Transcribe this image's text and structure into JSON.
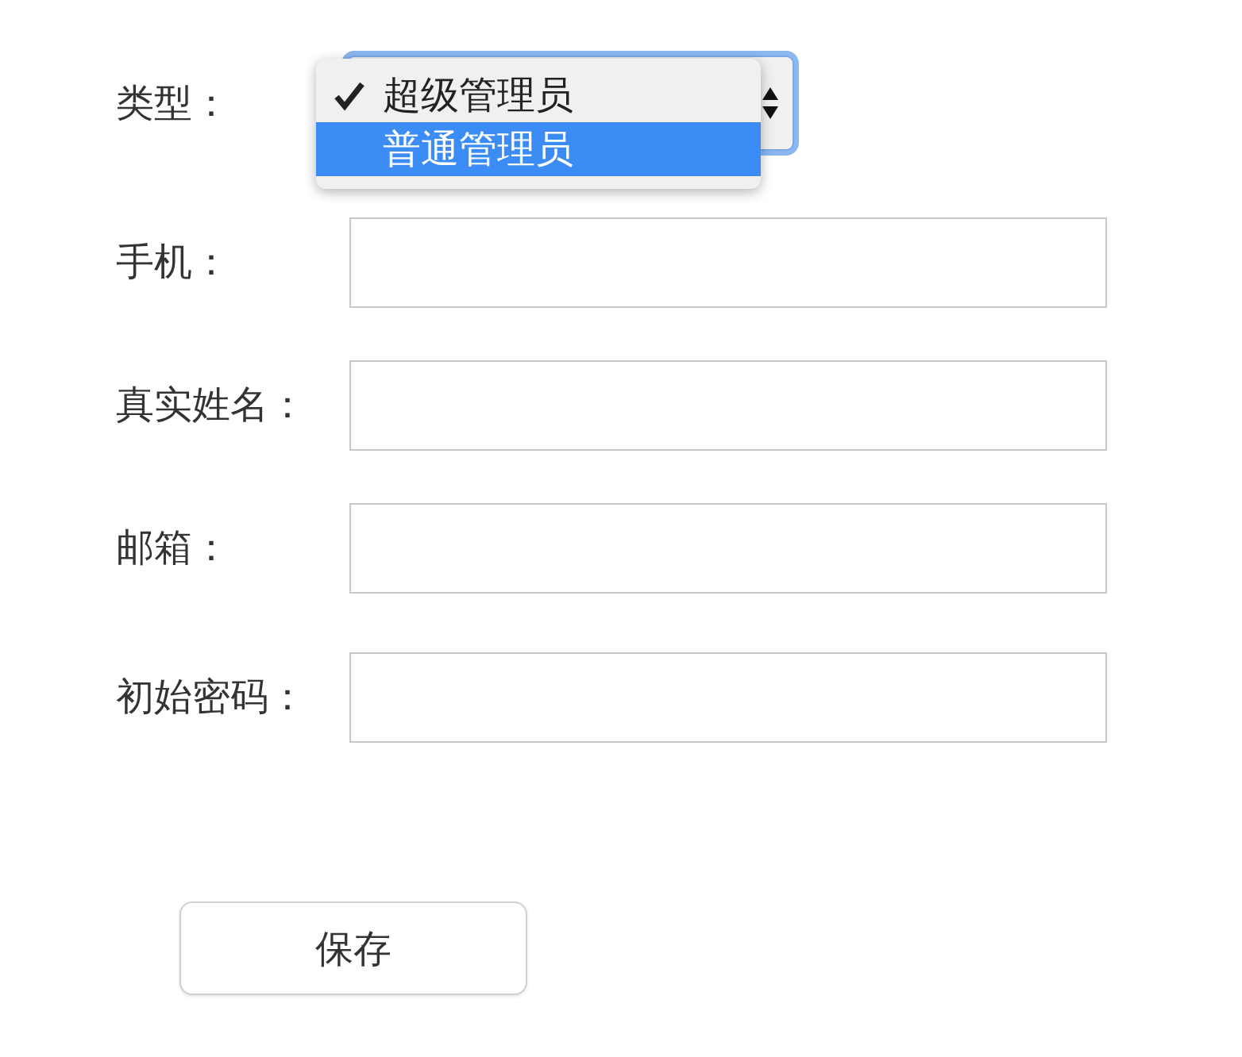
{
  "form": {
    "type_field": {
      "label": "类型：",
      "focused": true,
      "menu": [
        {
          "label": "超级管理员",
          "checked": true,
          "selected": false
        },
        {
          "label": "普通管理员",
          "checked": false,
          "selected": true
        }
      ]
    },
    "fields": [
      {
        "label": "手机："
      },
      {
        "label": "真实姓名："
      },
      {
        "label": "邮箱："
      },
      {
        "label": "初始密码："
      }
    ],
    "save_button": "保存"
  }
}
